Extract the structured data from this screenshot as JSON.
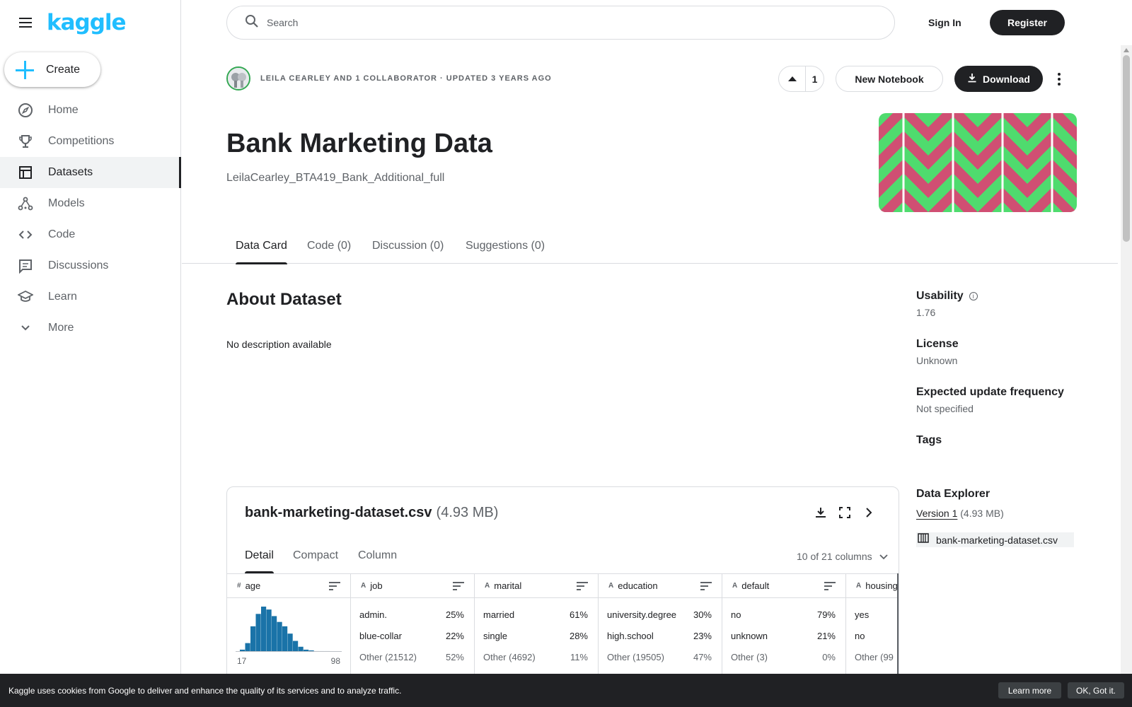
{
  "brand": {
    "logo_text": "kaggle",
    "accent_color": "#20beff"
  },
  "sidebar": {
    "create_label": "Create",
    "items": [
      {
        "label": "Home",
        "icon": "compass-icon"
      },
      {
        "label": "Competitions",
        "icon": "trophy-icon"
      },
      {
        "label": "Datasets",
        "icon": "table-icon",
        "active": true
      },
      {
        "label": "Models",
        "icon": "models-icon"
      },
      {
        "label": "Code",
        "icon": "code-icon"
      },
      {
        "label": "Discussions",
        "icon": "discussion-icon"
      },
      {
        "label": "Learn",
        "icon": "school-icon"
      },
      {
        "label": "More",
        "icon": "chevron-down-icon"
      }
    ]
  },
  "topbar": {
    "search_placeholder": "Search",
    "signin_label": "Sign In",
    "register_label": "Register"
  },
  "dataset": {
    "owner_line": "LEILA CEARLEY AND 1 COLLABORATOR · UPDATED 3 YEARS AGO",
    "vote_count": "1",
    "new_notebook_label": "New Notebook",
    "download_label": "Download",
    "title": "Bank Marketing Data",
    "subtitle": "LeilaCearley_BTA419_Bank_Additional_full",
    "cover_colors": [
      "#d04f73",
      "#4fdb6e"
    ]
  },
  "tabs": [
    {
      "label": "Data Card",
      "active": true
    },
    {
      "label": "Code (0)"
    },
    {
      "label": "Discussion (0)"
    },
    {
      "label": "Suggestions (0)"
    }
  ],
  "about": {
    "title": "About Dataset",
    "description": "No description available"
  },
  "meta": {
    "usability_label": "Usability",
    "usability_value": "1.76",
    "license_label": "License",
    "license_value": "Unknown",
    "frequency_label": "Expected update frequency",
    "frequency_value": "Not specified",
    "tags_label": "Tags",
    "explorer_label": "Data Explorer",
    "version_link": "Version 1",
    "version_size": "(4.93 MB)",
    "file_name": "bank-marketing-dataset.csv"
  },
  "explorer": {
    "file_name": "bank-marketing-dataset.csv",
    "file_size": "(4.93 MB)",
    "tabs": [
      "Detail",
      "Compact",
      "Column"
    ],
    "column_count": "10 of 21 columns",
    "columns": [
      {
        "name": "age",
        "type": "#",
        "histogram": [
          3,
          12,
          35,
          52,
          62,
          58,
          49,
          41,
          35,
          25,
          15,
          7,
          3,
          2,
          1,
          1,
          1
        ],
        "min": "17",
        "max": "98"
      },
      {
        "name": "job",
        "type": "A",
        "rows": [
          [
            "admin.",
            "25%"
          ],
          [
            "blue-collar",
            "22%"
          ],
          [
            "Other (21512)",
            "52%"
          ]
        ]
      },
      {
        "name": "marital",
        "type": "A",
        "rows": [
          [
            "married",
            "61%"
          ],
          [
            "single",
            "28%"
          ],
          [
            "Other (4692)",
            "11%"
          ]
        ]
      },
      {
        "name": "education",
        "type": "A",
        "rows": [
          [
            "university.degree",
            "30%"
          ],
          [
            "high.school",
            "23%"
          ],
          [
            "Other (19505)",
            "47%"
          ]
        ]
      },
      {
        "name": "default",
        "type": "A",
        "rows": [
          [
            "no",
            "79%"
          ],
          [
            "unknown",
            "21%"
          ],
          [
            "Other (3)",
            "0%"
          ]
        ]
      },
      {
        "name": "housing",
        "type": "A",
        "rows": [
          [
            "yes",
            ""
          ],
          [
            "no",
            ""
          ],
          [
            "Other (99",
            ""
          ]
        ]
      }
    ]
  },
  "cookie": {
    "text": "Kaggle uses cookies from Google to deliver and enhance the quality of its services and to analyze traffic.",
    "learn_more": "Learn more",
    "ok": "OK, Got it."
  }
}
